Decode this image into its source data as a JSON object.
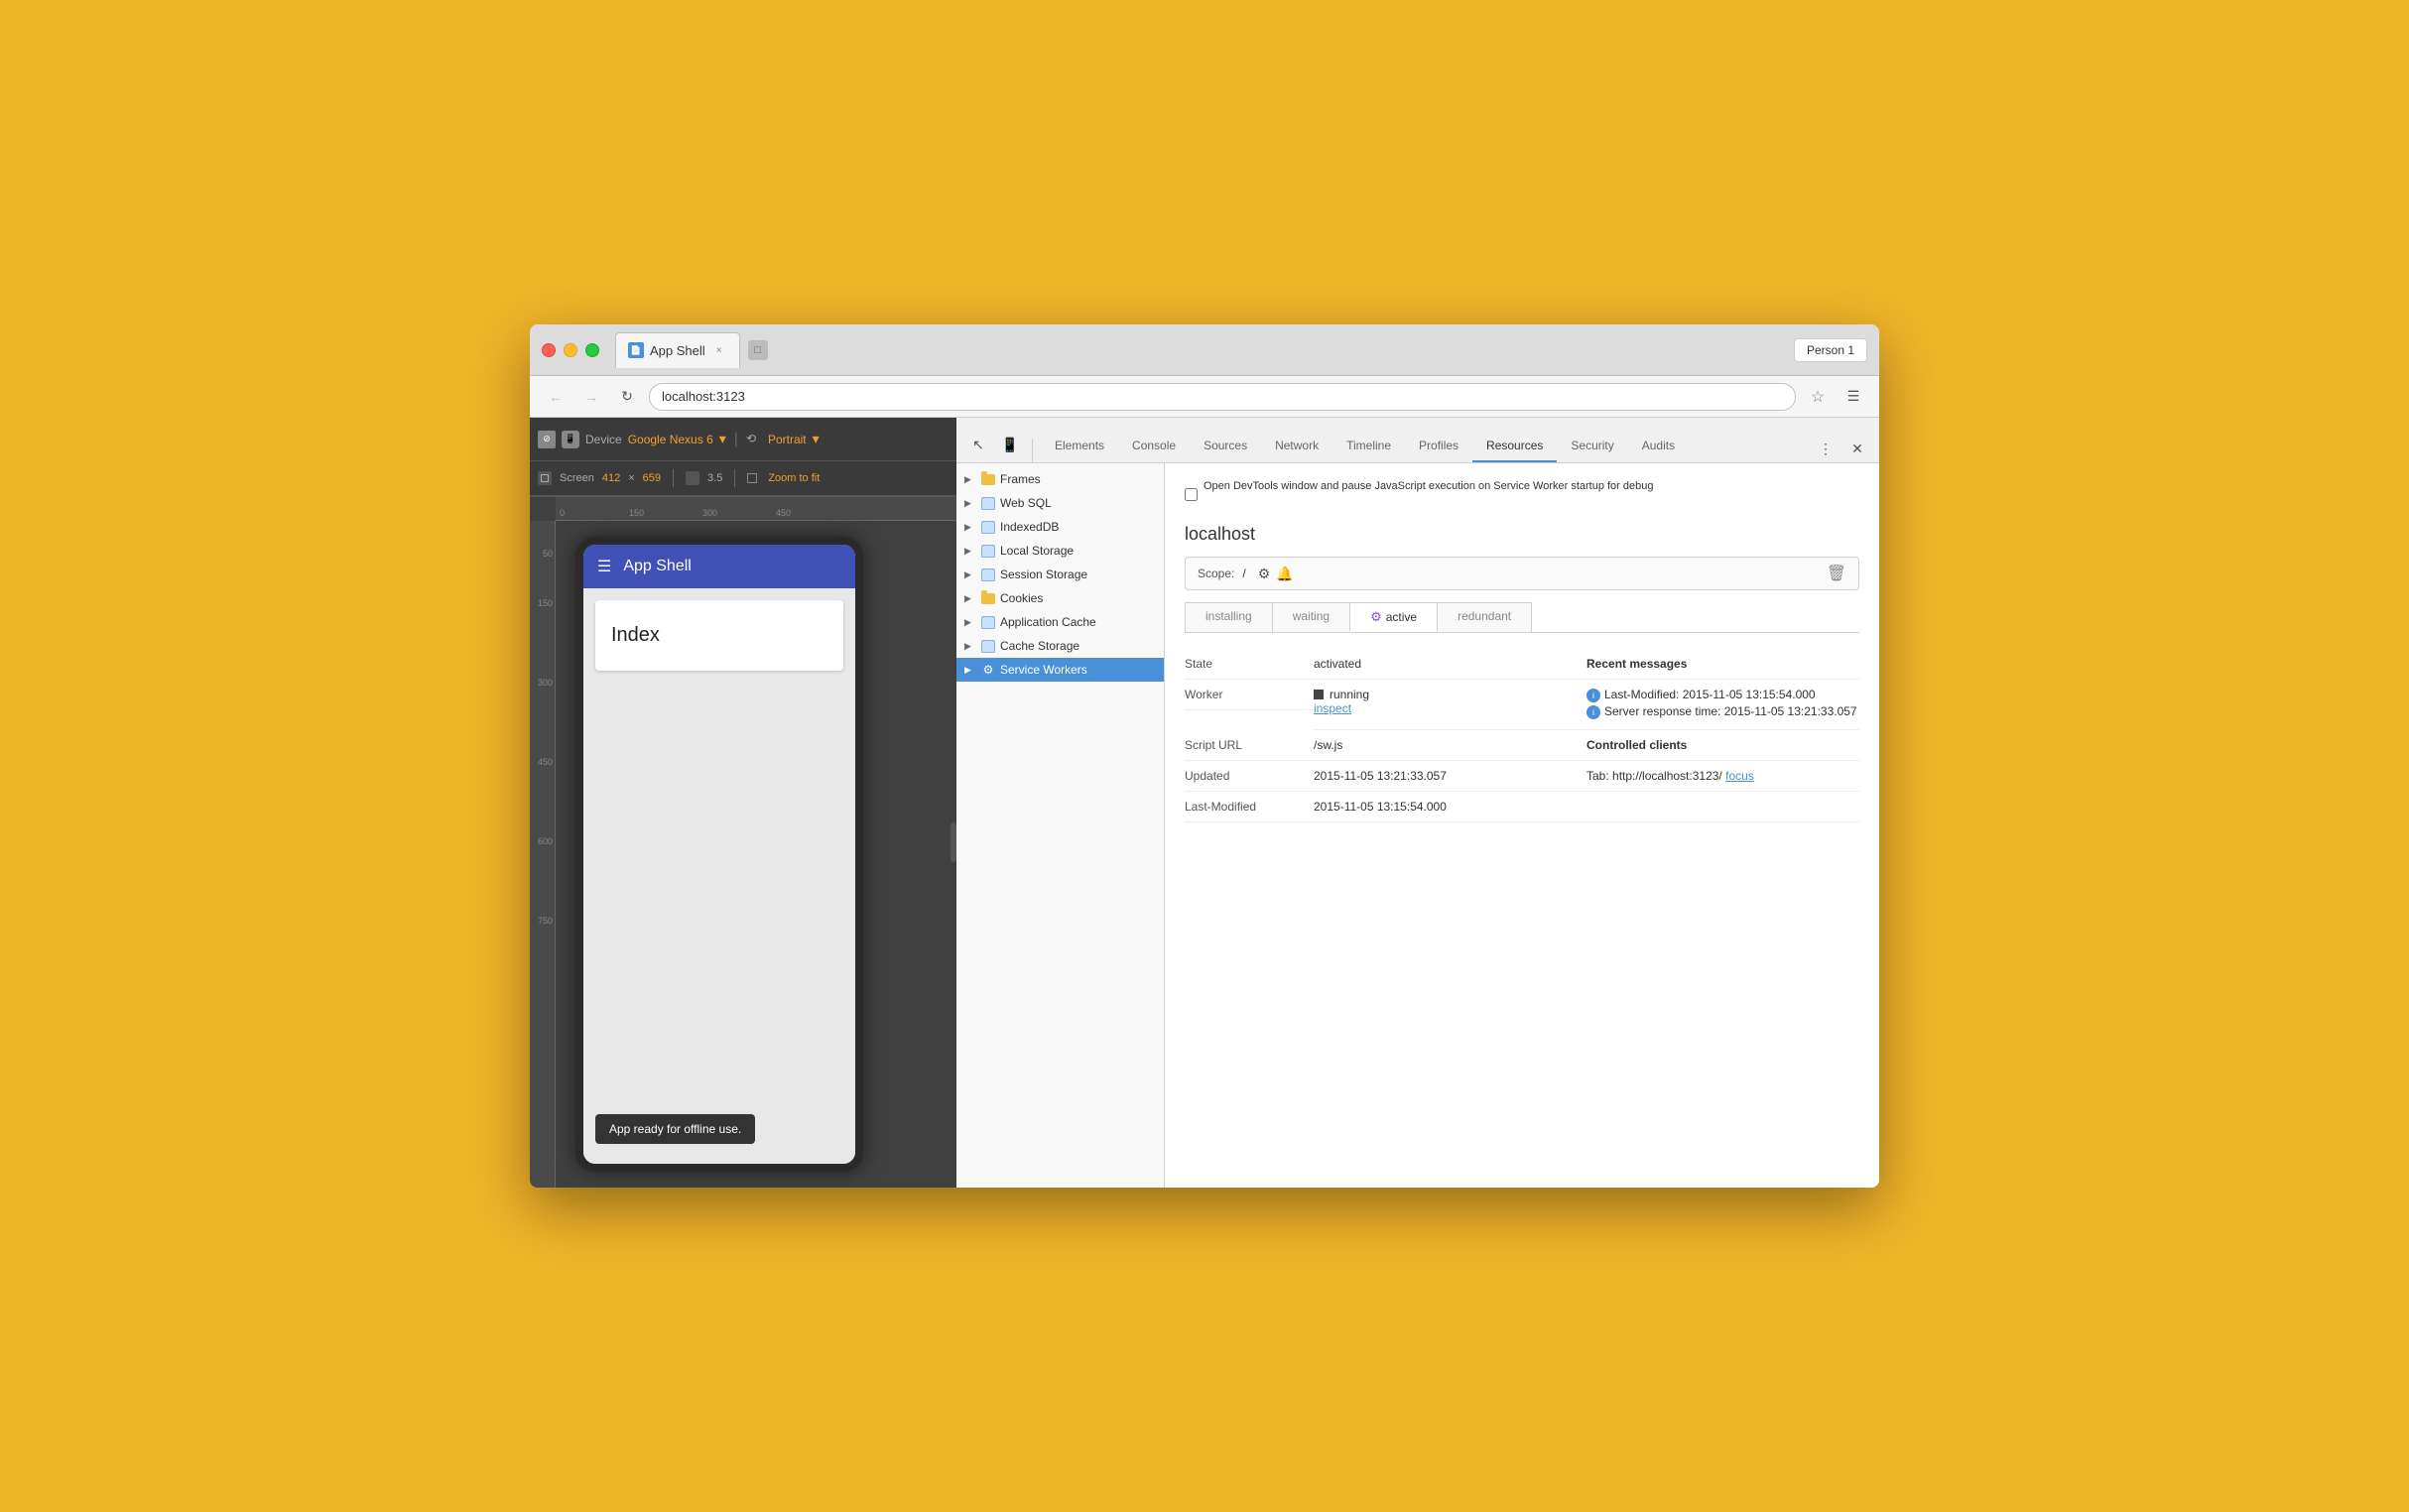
{
  "browser": {
    "tab_title": "App Shell",
    "tab_favicon": "📄",
    "close_label": "×",
    "address": "localhost:3123",
    "person": "Person 1"
  },
  "device_toolbar": {
    "device_label": "Device",
    "device_name": "Google Nexus 6",
    "orientation": "Portrait",
    "screen_label": "Screen",
    "width": "412",
    "cross": "×",
    "height": "659",
    "zoom": "3.5",
    "zoom_fit": "Zoom to fit",
    "ruler_h_ticks": [
      "0",
      "150",
      "300",
      "450"
    ],
    "ruler_v_ticks": [
      "50",
      "150",
      "300",
      "450",
      "600",
      "750"
    ]
  },
  "app_shell": {
    "title": "App Shell",
    "index_text": "Index",
    "offline_msg": "App ready for offline use."
  },
  "devtools": {
    "tabs": [
      "Elements",
      "Console",
      "Sources",
      "Network",
      "Timeline",
      "Profiles",
      "Resources",
      "Security",
      "Audits"
    ],
    "active_tab": "Resources",
    "notice": "Open DevTools window and pause JavaScript execution on Service Worker startup for debug",
    "host": "localhost",
    "scope_label": "Scope:",
    "scope_value": "/",
    "status_tabs": [
      "installing",
      "waiting",
      "active",
      "redundant"
    ],
    "active_status": "active",
    "state_label": "State",
    "state_value": "activated",
    "worker_label": "Worker",
    "worker_state": "running",
    "worker_inspect": "inspect",
    "script_url_label": "Script URL",
    "script_url": "/sw.js",
    "updated_label": "Updated",
    "updated_value": "2015-11-05 13:21:33.057",
    "last_modified_label": "Last-Modified",
    "last_modified_value": "2015-11-05 13:15:54.000",
    "recent_msgs_label": "Recent messages",
    "msg1": "Last-Modified: 2015-11-05 13:15:54.000",
    "msg2": "Server response time: 2015-11-05 13:21:33.057",
    "controlled_clients_label": "Controlled clients",
    "client_tab": "Tab: http://localhost:3123/",
    "client_focus": "focus"
  },
  "resources_tree": {
    "items": [
      {
        "label": "Frames",
        "type": "folder",
        "expanded": false
      },
      {
        "label": "Web SQL",
        "type": "db",
        "expanded": false
      },
      {
        "label": "IndexedDB",
        "type": "db",
        "expanded": false
      },
      {
        "label": "Local Storage",
        "type": "db",
        "expanded": false
      },
      {
        "label": "Session Storage",
        "type": "db",
        "expanded": false
      },
      {
        "label": "Cookies",
        "type": "folder",
        "expanded": false
      },
      {
        "label": "Application Cache",
        "type": "db",
        "expanded": false
      },
      {
        "label": "Cache Storage",
        "type": "db",
        "expanded": false
      },
      {
        "label": "Service Workers",
        "type": "sw",
        "expanded": false,
        "selected": true
      }
    ]
  }
}
